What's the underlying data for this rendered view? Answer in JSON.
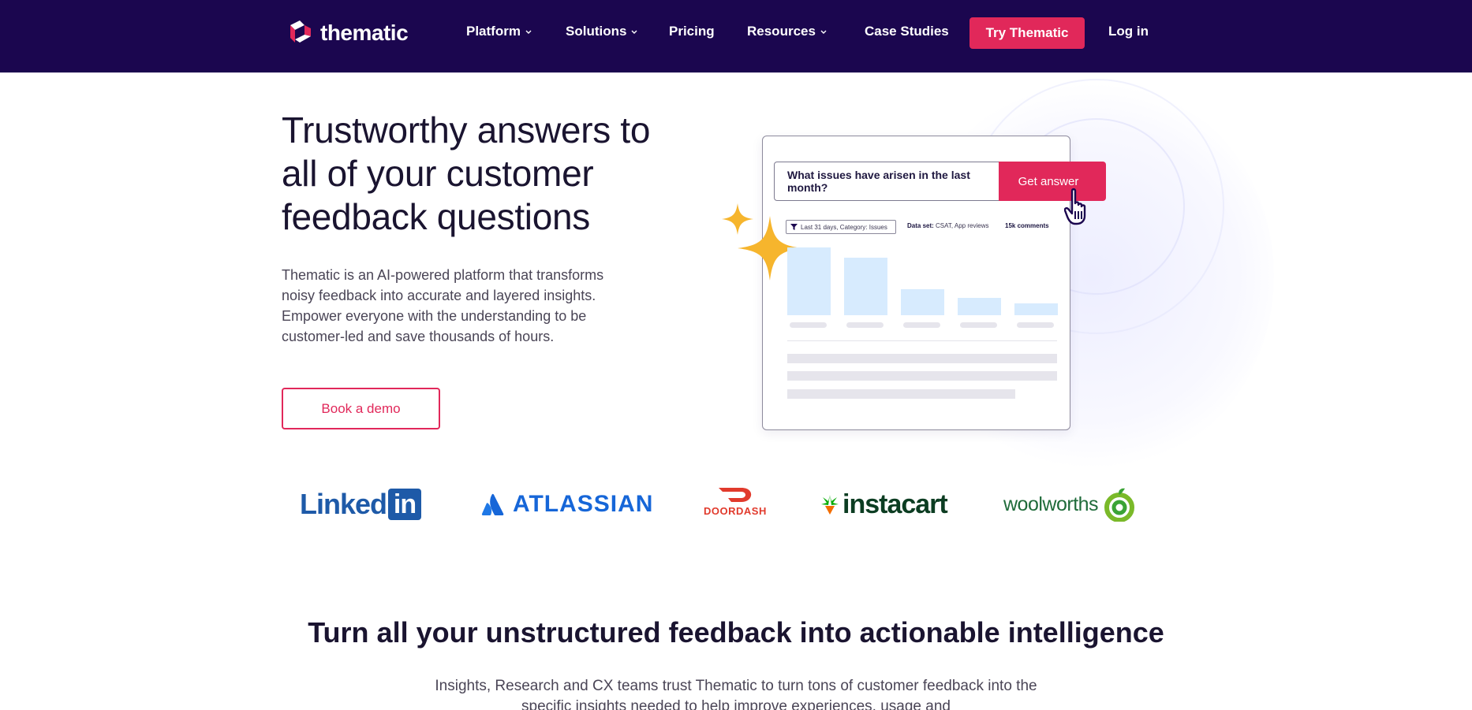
{
  "nav": {
    "logo_text": "thematic",
    "items": [
      {
        "label": "Platform",
        "dropdown": true
      },
      {
        "label": "Solutions",
        "dropdown": true
      },
      {
        "label": "Pricing",
        "dropdown": false
      },
      {
        "label": "Resources",
        "dropdown": true
      },
      {
        "label": "Case Studies",
        "dropdown": false
      }
    ],
    "cta_label": "Try Thematic",
    "login_label": "Log in"
  },
  "hero": {
    "title": "Trustworthy answers to all of your customer feedback questions",
    "description": "Thematic is an AI-powered platform that transforms noisy feedback into accurate and layered insights. Empower everyone with the understanding to be customer-led and save thousands of hours.",
    "demo_button": "Book a demo"
  },
  "illustration": {
    "query": "What issues have arisen in the last month?",
    "get_answer": "Get answer",
    "filter": "Last 31 days, Category: Issues",
    "dataset_label": "Data set:",
    "dataset_value": "CSAT, App reviews",
    "comments": "15k comments",
    "bar_levels": [
      1.0,
      0.85,
      0.38,
      0.25,
      0.18
    ]
  },
  "logos": {
    "linkedin_a": "Linked",
    "linkedin_b": "in",
    "atlassian": "ATLASSIAN",
    "doordash": "DOORDASH",
    "instacart": "instacart",
    "woolworths": "woolworths"
  },
  "section2": {
    "title": "Turn all your unstructured feedback into actionable intelligence",
    "description": "Insights, Research and CX teams trust Thematic to turn tons of customer feedback into the specific insights needed to help improve experiences, usage and"
  },
  "colors": {
    "nav_bg": "#1b064f",
    "accent": "#e1285a",
    "bar": "#d7ebfe"
  }
}
